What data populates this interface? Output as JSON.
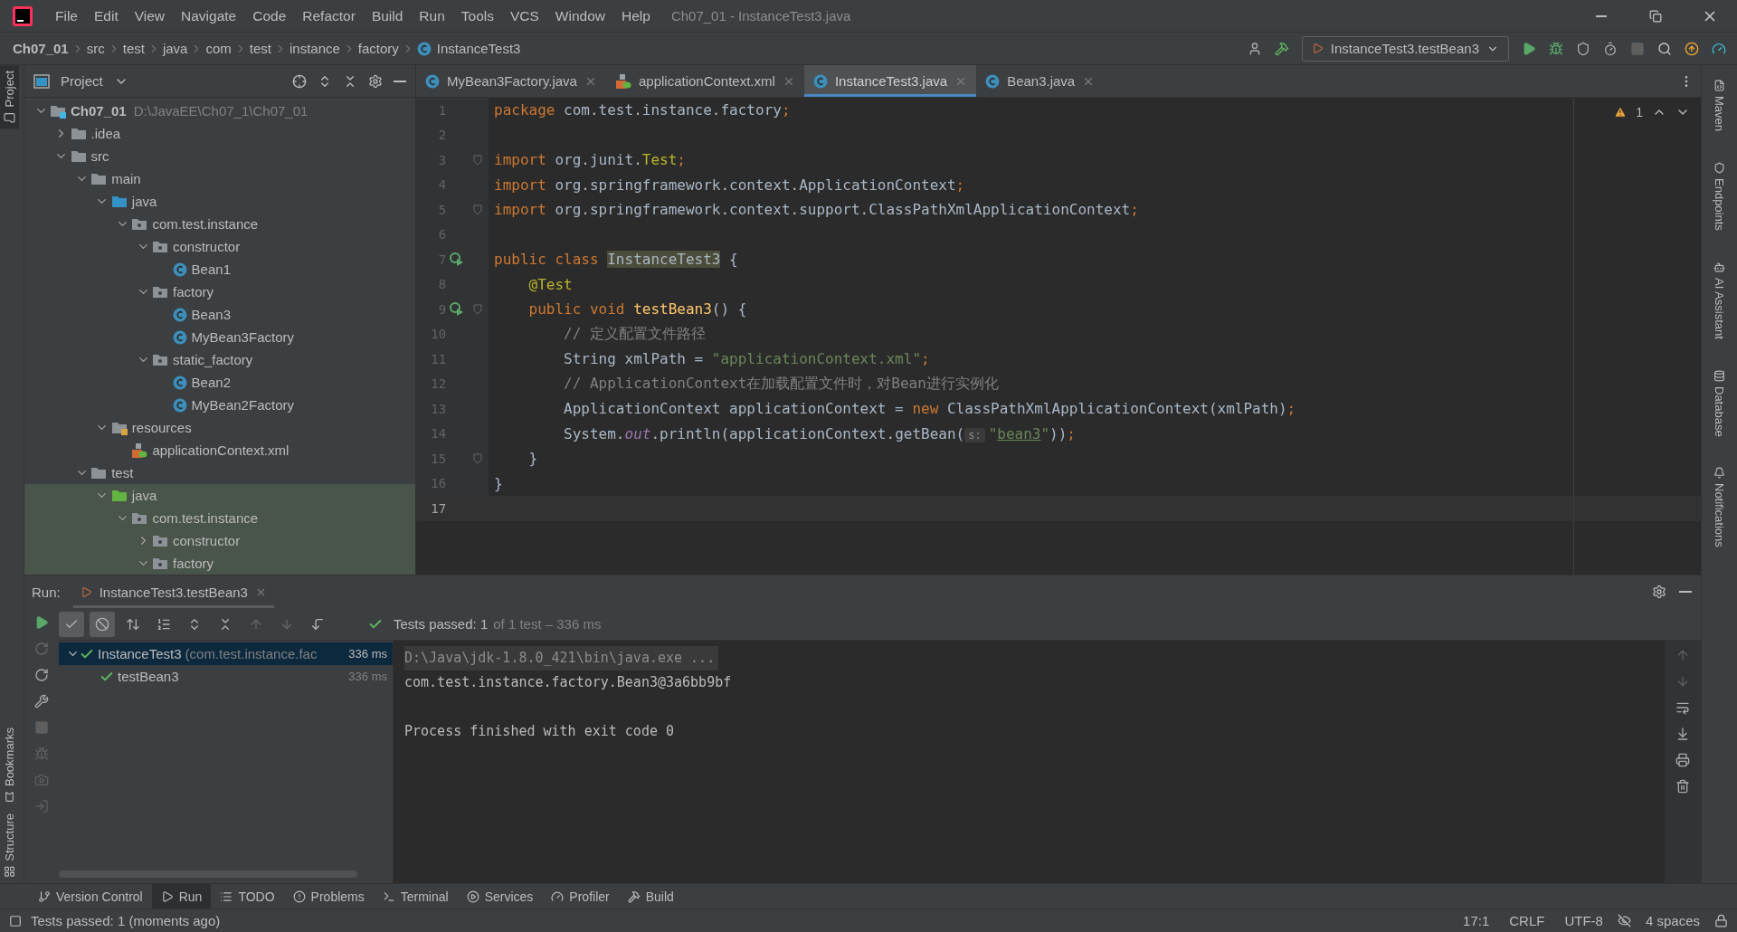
{
  "title_bar": {
    "menu": [
      "File",
      "Edit",
      "View",
      "Navigate",
      "Code",
      "Refactor",
      "Build",
      "Run",
      "Tools",
      "VCS",
      "Window",
      "Help"
    ],
    "title": "Ch07_01 - InstanceTest3.java"
  },
  "nav_bar": {
    "breadcrumbs": [
      {
        "label": "Ch07_01",
        "kind": "project"
      },
      {
        "label": "src",
        "kind": "dir"
      },
      {
        "label": "test",
        "kind": "dir"
      },
      {
        "label": "java",
        "kind": "dir"
      },
      {
        "label": "com",
        "kind": "dir"
      },
      {
        "label": "test",
        "kind": "dir"
      },
      {
        "label": "instance",
        "kind": "dir"
      },
      {
        "label": "factory",
        "kind": "dir"
      },
      {
        "label": "InstanceTest3",
        "kind": "class"
      }
    ],
    "run_config": "InstanceTest3.testBean3"
  },
  "left_stripe": {
    "top": [
      {
        "label": "Project",
        "selected": true
      }
    ],
    "bottom": [
      {
        "label": "Bookmarks",
        "selected": false
      },
      {
        "label": "Structure",
        "selected": false
      }
    ]
  },
  "right_stripe": [
    "Maven",
    "Endpoints",
    "AI Assistant",
    "Database",
    "Notifications"
  ],
  "project": {
    "title": "Project",
    "tree": [
      {
        "label": "Ch07_01",
        "kind": "module",
        "path": "D:\\JavaEE\\Ch07_1\\Ch07_01",
        "expanded": true,
        "children": [
          {
            "label": ".idea",
            "kind": "folder",
            "expanded": false
          },
          {
            "label": "src",
            "kind": "folder",
            "expanded": true,
            "children": [
              {
                "label": "main",
                "kind": "folder",
                "expanded": true,
                "children": [
                  {
                    "label": "java",
                    "kind": "source",
                    "expanded": true,
                    "children": [
                      {
                        "label": "com.test.instance",
                        "kind": "package",
                        "expanded": true,
                        "children": [
                          {
                            "label": "constructor",
                            "kind": "package",
                            "expanded": true,
                            "children": [
                              {
                                "label": "Bean1",
                                "kind": "class"
                              }
                            ]
                          },
                          {
                            "label": "factory",
                            "kind": "package",
                            "expanded": true,
                            "children": [
                              {
                                "label": "Bean3",
                                "kind": "class"
                              },
                              {
                                "label": "MyBean3Factory",
                                "kind": "class"
                              }
                            ]
                          },
                          {
                            "label": "static_factory",
                            "kind": "package",
                            "expanded": true,
                            "children": [
                              {
                                "label": "Bean2",
                                "kind": "class"
                              },
                              {
                                "label": "MyBean2Factory",
                                "kind": "class"
                              }
                            ]
                          }
                        ]
                      }
                    ]
                  },
                  {
                    "label": "resources",
                    "kind": "resources",
                    "expanded": true,
                    "children": [
                      {
                        "label": "applicationContext.xml",
                        "kind": "xml"
                      }
                    ]
                  }
                ]
              },
              {
                "label": "test",
                "kind": "folder",
                "expanded": true,
                "children": [
                  {
                    "label": "java",
                    "kind": "test-source",
                    "expanded": true,
                    "children": [
                      {
                        "label": "com.test.instance",
                        "kind": "package",
                        "expanded": true,
                        "children": [
                          {
                            "label": "constructor",
                            "kind": "package",
                            "expanded": false
                          },
                          {
                            "label": "factory",
                            "kind": "package",
                            "expanded": true
                          }
                        ]
                      }
                    ]
                  }
                ]
              }
            ]
          }
        ]
      }
    ]
  },
  "editor": {
    "tabs": [
      {
        "label": "MyBean3Factory.java",
        "kind": "class",
        "selected": false
      },
      {
        "label": "applicationContext.xml",
        "kind": "xml",
        "selected": false
      },
      {
        "label": "InstanceTest3.java",
        "kind": "class",
        "selected": true
      },
      {
        "label": "Bean3.java",
        "kind": "class",
        "selected": false
      }
    ],
    "warnings": "1",
    "lines": [
      {
        "number": "1",
        "current": false,
        "run_marker": false,
        "fold_marker": false,
        "tokens": [
          {
            "text": "package",
            "kind": "kw"
          },
          {
            "text": " com.test.instance.factory",
            "kind": "plain"
          },
          {
            "text": ";",
            "kind": "kw"
          }
        ]
      },
      {
        "number": "2",
        "current": false,
        "run_marker": false,
        "fold_marker": false
      },
      {
        "number": "3",
        "current": false,
        "run_marker": false,
        "fold_marker": true,
        "tokens": [
          {
            "text": "import",
            "kind": "kw"
          },
          {
            "text": " org.junit.",
            "kind": "plain"
          },
          {
            "text": "Test",
            "kind": "ann"
          },
          {
            "text": ";",
            "kind": "kw"
          }
        ]
      },
      {
        "number": "4",
        "current": false,
        "run_marker": false,
        "fold_marker": false,
        "tokens": [
          {
            "text": "import",
            "kind": "kw"
          },
          {
            "text": " org.springframework.context.ApplicationContext",
            "kind": "plain"
          },
          {
            "text": ";",
            "kind": "kw"
          }
        ]
      },
      {
        "number": "5",
        "current": false,
        "run_marker": false,
        "fold_marker": true,
        "tokens": [
          {
            "text": "import",
            "kind": "kw"
          },
          {
            "text": " org.springframework.context.support.ClassPathXmlApplicationContext",
            "kind": "plain"
          },
          {
            "text": ";",
            "kind": "kw"
          }
        ]
      },
      {
        "number": "6",
        "current": false,
        "run_marker": false,
        "fold_marker": false
      },
      {
        "number": "7",
        "current": false,
        "run_marker": true,
        "fold_marker": false,
        "tokens": [
          {
            "text": "public class ",
            "kind": "kw"
          },
          {
            "text": "InstanceTest3",
            "kind": "mark"
          },
          {
            "text": " {",
            "kind": "plain"
          }
        ]
      },
      {
        "number": "8",
        "current": false,
        "run_marker": false,
        "fold_marker": false,
        "tokens": [
          {
            "text": "    @Test",
            "kind": "ann"
          }
        ]
      },
      {
        "number": "9",
        "current": false,
        "run_marker": true,
        "fold_marker": true,
        "tokens": [
          {
            "text": "    public void ",
            "kind": "kw"
          },
          {
            "text": "testBean3",
            "kind": "fn"
          },
          {
            "text": "() {",
            "kind": "plain"
          }
        ]
      },
      {
        "number": "10",
        "current": false,
        "run_marker": false,
        "fold_marker": false,
        "tokens": [
          {
            "text": "        // 定义配置文件路径",
            "kind": "cmt"
          }
        ]
      },
      {
        "number": "11",
        "current": false,
        "run_marker": false,
        "fold_marker": false,
        "tokens": [
          {
            "text": "        String xmlPath = ",
            "kind": "plain"
          },
          {
            "text": "\"applicationContext.xml\"",
            "kind": "str"
          },
          {
            "text": ";",
            "kind": "kw"
          }
        ]
      },
      {
        "number": "12",
        "current": false,
        "run_marker": false,
        "fold_marker": false,
        "tokens": [
          {
            "text": "        // ApplicationContext在加载配置文件时，对Bean进行实例化",
            "kind": "cmt"
          }
        ]
      },
      {
        "number": "13",
        "current": false,
        "run_marker": false,
        "fold_marker": false,
        "tokens": [
          {
            "text": "        ApplicationContext applicationContext = ",
            "kind": "plain"
          },
          {
            "text": "new ",
            "kind": "kw"
          },
          {
            "text": "ClassPathXmlApplicationContext(xmlPath)",
            "kind": "plain"
          },
          {
            "text": ";",
            "kind": "kw"
          }
        ]
      },
      {
        "number": "14",
        "current": false,
        "run_marker": false,
        "fold_marker": false,
        "tokens": [
          {
            "text": "        System.",
            "kind": "plain"
          },
          {
            "text": "out",
            "kind": "field"
          },
          {
            "text": ".println(applicationContext.getBean(",
            "kind": "plain"
          },
          {
            "text": "s:",
            "kind": "hint"
          },
          {
            "text": "\"",
            "kind": "str"
          },
          {
            "text": "bean3",
            "kind": "link"
          },
          {
            "text": "\"",
            "kind": "str"
          },
          {
            "text": "))",
            "kind": "plain"
          },
          {
            "text": ";",
            "kind": "kw"
          }
        ]
      },
      {
        "number": "15",
        "current": false,
        "run_marker": false,
        "fold_marker": true,
        "tokens": [
          {
            "text": "    }",
            "kind": "plain"
          }
        ]
      },
      {
        "number": "16",
        "current": false,
        "run_marker": false,
        "fold_marker": false,
        "tokens": [
          {
            "text": "}",
            "kind": "plain"
          }
        ]
      },
      {
        "number": "17",
        "current": true,
        "run_marker": false,
        "fold_marker": false
      }
    ]
  },
  "run": {
    "label": "Run:",
    "tab": "InstanceTest3.testBean3",
    "toggles": [
      {
        "kind": "passed",
        "selected": true
      },
      {
        "kind": "ignored",
        "selected": true
      }
    ],
    "summary": "Tests passed: 1",
    "summary_detail": "of 1 test – 336 ms",
    "tests": [
      {
        "label": "InstanceTest3",
        "detail": "(com.test.instance.fac",
        "time": "336 ms",
        "passed": true,
        "selected": true,
        "expanded": true,
        "children": [
          {
            "label": "testBean3",
            "time": "336 ms",
            "passed": true,
            "selected": false
          }
        ]
      }
    ],
    "console": [
      {
        "text": "D:\\Java\\jdk-1.8.0_421\\bin\\java.exe ...",
        "kind": "command"
      },
      {
        "text": "com.test.instance.factory.Bean3@3a6bb9bf",
        "kind": "output"
      },
      {
        "text": "Process finished with exit code 0",
        "kind": "exit"
      }
    ]
  },
  "tool_tabs": [
    {
      "label": "Version Control",
      "kind": "vcs",
      "selected": false
    },
    {
      "label": "Run",
      "kind": "run",
      "selected": true
    },
    {
      "label": "TODO",
      "kind": "todo",
      "selected": false
    },
    {
      "label": "Problems",
      "kind": "problems",
      "selected": false
    },
    {
      "label": "Terminal",
      "kind": "terminal",
      "selected": false
    },
    {
      "label": "Services",
      "kind": "services",
      "selected": false
    },
    {
      "label": "Profiler",
      "kind": "profiler",
      "selected": false
    },
    {
      "label": "Build",
      "kind": "build",
      "selected": false
    }
  ],
  "status_bar": {
    "message": "Tests passed: 1 (moments ago)",
    "items": [
      "17:1",
      "CRLF",
      "UTF-8",
      "4 spaces"
    ]
  }
}
